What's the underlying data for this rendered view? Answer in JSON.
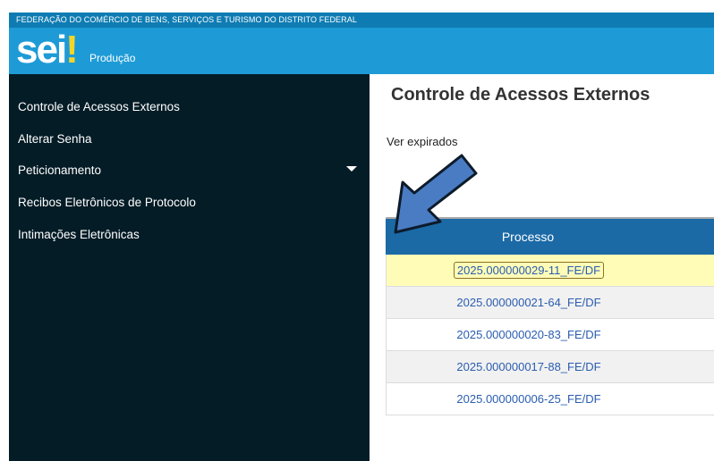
{
  "header": {
    "organization": "FEDERAÇÃO DO COMÉRCIO DE BENS, SERVIÇOS E TURISMO DO DISTRITO FEDERAL",
    "logo_text": "sei",
    "logo_mark": "!",
    "environment": "Produção"
  },
  "sidebar": {
    "items": [
      {
        "label": "Controle de Acessos Externos"
      },
      {
        "label": "Alterar Senha"
      },
      {
        "label": "Peticionamento",
        "icon": "caret-down-icon"
      },
      {
        "label": "Recibos Eletrônicos de Protocolo"
      },
      {
        "label": "Intimações Eletrônicas"
      }
    ]
  },
  "main": {
    "title": "Controle de Acessos Externos",
    "expired_link": "Ver expirados",
    "table": {
      "columns": [
        "Processo"
      ],
      "rows": [
        {
          "processo": "2025.000000029-11_FE/DF"
        },
        {
          "processo": "2025.000000021-64_FE/DF"
        },
        {
          "processo": "2025.000000020-83_FE/DF"
        },
        {
          "processo": "2025.000000017-88_FE/DF"
        },
        {
          "processo": "2025.000000006-25_FE/DF"
        }
      ]
    }
  },
  "colors": {
    "org_bar": "#0e7cb3",
    "brand_bar": "#1e9bd7",
    "sidebar_bg": "#041c26",
    "table_header": "#1b6aa6",
    "highlight_row": "#fffcb8",
    "link": "#2a5db0",
    "annotation_arrow": "#4a7cc4"
  },
  "annotation": {
    "icon": "pointer-arrow-icon"
  }
}
